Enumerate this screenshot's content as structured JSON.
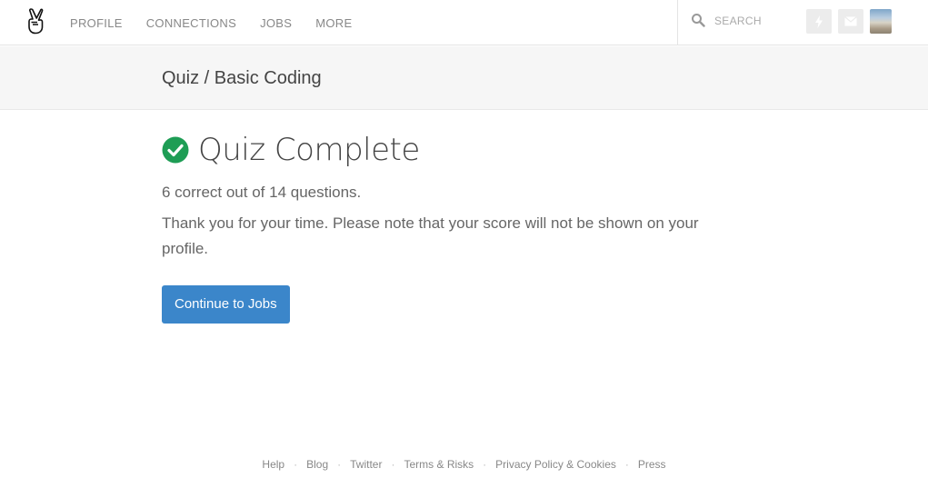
{
  "nav": {
    "links": [
      "PROFILE",
      "CONNECTIONS",
      "JOBS",
      "MORE"
    ],
    "search_placeholder": "SEARCH"
  },
  "breadcrumb": "Quiz / Basic Coding",
  "main": {
    "title": "Quiz Complete",
    "score": "6 correct out of 14 questions.",
    "note": "Thank you for your time. Please note that your score will not be shown on your profile.",
    "continue_label": "Continue to Jobs"
  },
  "footer": {
    "links": [
      "Help",
      "Blog",
      "Twitter",
      "Terms & Risks",
      "Privacy Policy & Cookies",
      "Press"
    ],
    "separator": "·"
  },
  "colors": {
    "accent_button": "#3b86ca",
    "success_check": "#1e9d55"
  }
}
